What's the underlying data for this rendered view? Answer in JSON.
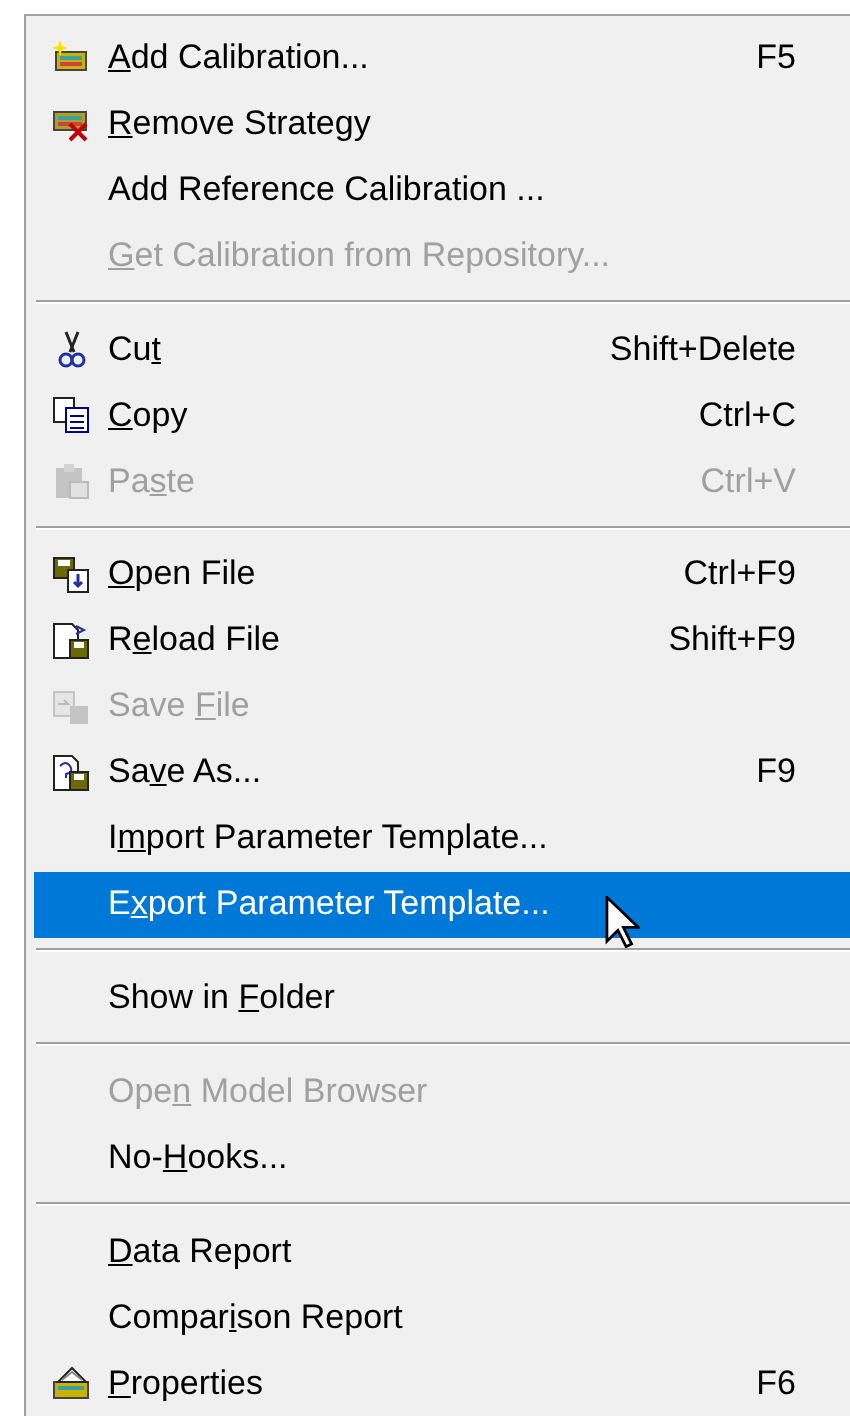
{
  "menu": {
    "items": [
      {
        "kind": "item",
        "label": {
          "key": "A",
          "after": "dd Calibration..."
        },
        "shortcut": "F5",
        "disabled": false,
        "highlighted": false
      },
      {
        "kind": "item",
        "label": {
          "key": "R",
          "after": "emove Strategy"
        },
        "disabled": false,
        "highlighted": false
      },
      {
        "kind": "item",
        "label": {
          "before": "Add Reference Calibration ..."
        },
        "disabled": false,
        "highlighted": false
      },
      {
        "kind": "item",
        "label": {
          "key": "G",
          "after": "et Calibration from Repository..."
        },
        "disabled": true,
        "highlighted": false
      },
      {
        "kind": "separator"
      },
      {
        "kind": "item",
        "label": {
          "before": "Cu",
          "key": "t"
        },
        "shortcut": "Shift+Delete",
        "disabled": false,
        "highlighted": false
      },
      {
        "kind": "item",
        "label": {
          "key": "C",
          "after": "opy"
        },
        "shortcut": "Ctrl+C",
        "disabled": false,
        "highlighted": false
      },
      {
        "kind": "item",
        "label": {
          "before": "Pa",
          "key": "s",
          "after": "te"
        },
        "shortcut": "Ctrl+V",
        "disabled": true,
        "highlighted": false
      },
      {
        "kind": "separator"
      },
      {
        "kind": "item",
        "label": {
          "key": "O",
          "after": "pen File"
        },
        "shortcut": "Ctrl+F9",
        "disabled": false,
        "highlighted": false
      },
      {
        "kind": "item",
        "label": {
          "before": "R",
          "key": "e",
          "after": "load File"
        },
        "shortcut": "Shift+F9",
        "disabled": false,
        "highlighted": false
      },
      {
        "kind": "item",
        "label": {
          "before": "Save ",
          "key": "F",
          "after": "ile"
        },
        "disabled": true,
        "highlighted": false
      },
      {
        "kind": "item",
        "label": {
          "before": "Sa",
          "key": "v",
          "after": "e As..."
        },
        "shortcut": "F9",
        "disabled": false,
        "highlighted": false
      },
      {
        "kind": "item",
        "label": {
          "before": "I",
          "key": "m",
          "after": "port Parameter Template..."
        },
        "disabled": false,
        "highlighted": false
      },
      {
        "kind": "item",
        "label": {
          "before": "E",
          "key": "x",
          "after": "port Parameter Template..."
        },
        "disabled": false,
        "highlighted": true
      },
      {
        "kind": "separator"
      },
      {
        "kind": "item",
        "label": {
          "before": "Show in ",
          "key": "F",
          "after": "older"
        },
        "disabled": false,
        "highlighted": false
      },
      {
        "kind": "separator"
      },
      {
        "kind": "item",
        "label": {
          "before": "Ope",
          "key": "n",
          "after": " Model Browser"
        },
        "disabled": true,
        "highlighted": false
      },
      {
        "kind": "item",
        "label": {
          "before": "No-",
          "key": "H",
          "after": "ooks..."
        },
        "disabled": false,
        "highlighted": false
      },
      {
        "kind": "separator"
      },
      {
        "kind": "item",
        "label": {
          "key": "D",
          "after": "ata Report"
        },
        "disabled": false,
        "highlighted": false
      },
      {
        "kind": "item",
        "label": {
          "before": "Compar",
          "key": "i",
          "after": "son Report"
        },
        "disabled": false,
        "highlighted": false
      },
      {
        "kind": "item",
        "label": {
          "key": "P",
          "after": "roperties"
        },
        "shortcut": "F6",
        "disabled": false,
        "highlighted": false
      }
    ]
  }
}
